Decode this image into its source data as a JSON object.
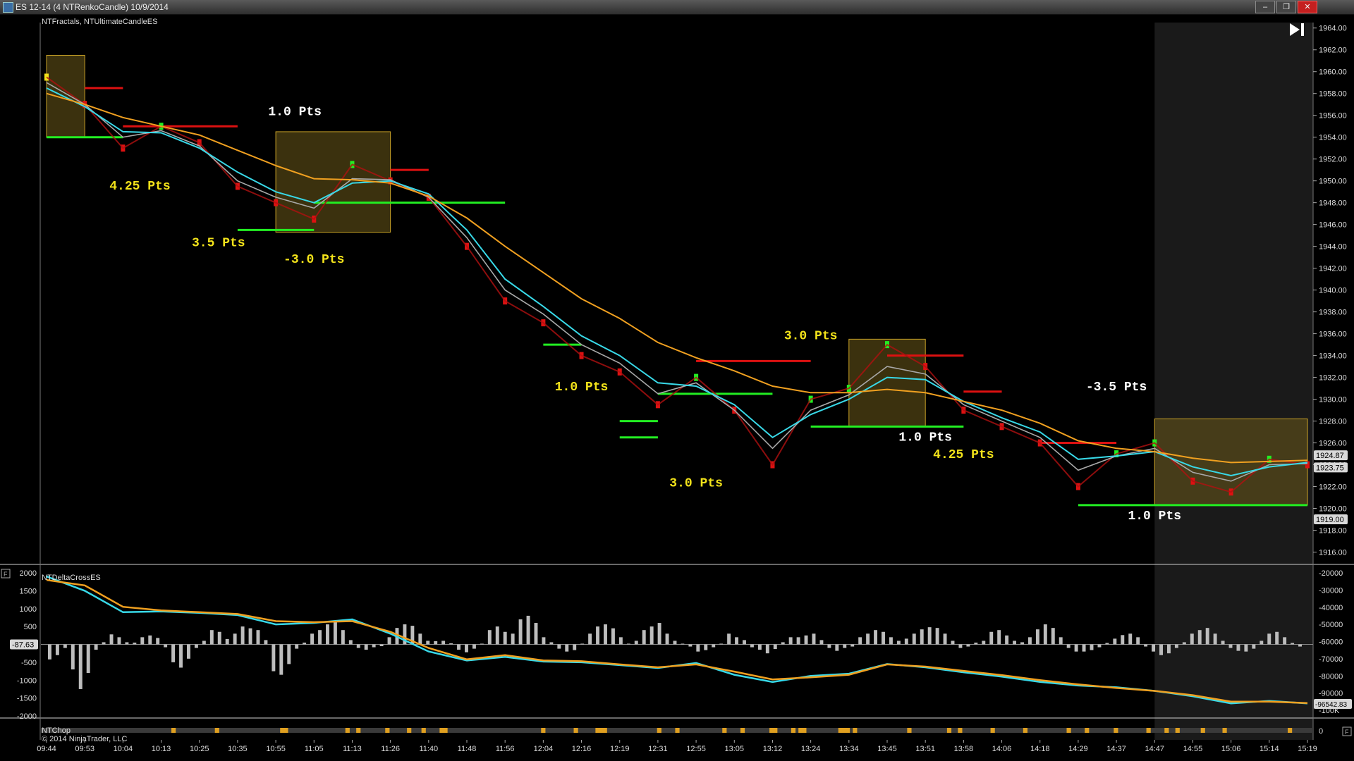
{
  "window": {
    "title": "ES 12-14 (4 NTRenkoCandle)  10/9/2014",
    "minimize": "–",
    "restore": "❐",
    "close": "✕"
  },
  "colors": {
    "background": "#000000",
    "bull": "#22ee22",
    "bear": "#dd1111",
    "neutral": "#f2e21a",
    "cyan_ma": "#38d9e8",
    "orange_ma": "#f0a020",
    "grey_ma": "#a8a8a8",
    "magenta": "#cc22cc",
    "box_fill": "#6b5a1a",
    "text_white": "#ffffff",
    "text_yellow": "#f2e21a"
  },
  "indicators": {
    "main": "NTFractals, NTUltimateCandleES",
    "delta": "NTDeltaCrossES",
    "chop": "NTChop",
    "copyright": "© 2014 NinjaTrader, LLC"
  },
  "play_icon": "skip-forward-icon",
  "chart_data": [
    {
      "type": "line",
      "name": "price-panel",
      "x": [
        "09:44",
        "09:53",
        "10:04",
        "10:13",
        "10:25",
        "10:35",
        "10:55",
        "11:05",
        "11:13",
        "11:26",
        "11:40",
        "11:48",
        "11:56",
        "12:04",
        "12:16",
        "12:19",
        "12:31",
        "12:55",
        "13:05",
        "13:12",
        "13:24",
        "13:34",
        "13:45",
        "13:51",
        "13:58",
        "14:06",
        "14:18",
        "14:29",
        "14:37",
        "14:47",
        "14:55",
        "15:06",
        "15:14",
        "15:19"
      ],
      "ylim": [
        1915,
        1964.5
      ],
      "yticks": [
        "1964.00",
        "1962.00",
        "1960.00",
        "1958.00",
        "1956.00",
        "1954.00",
        "1952.00",
        "1950.00",
        "1948.00",
        "1946.00",
        "1944.00",
        "1942.00",
        "1940.00",
        "1938.00",
        "1936.00",
        "1934.00",
        "1932.00",
        "1930.00",
        "1928.00",
        "1926.00",
        "1924.00",
        "1922.00",
        "1920.00",
        "1918.00",
        "1916.00"
      ],
      "series": [
        {
          "key": "price",
          "values": [
            1959.5,
            1957.0,
            1953.0,
            1955.0,
            1953.5,
            1949.5,
            1948.0,
            1946.5,
            1951.5,
            1950.0,
            1948.5,
            1944.0,
            1939.0,
            1937.0,
            1934.0,
            1932.5,
            1929.5,
            1932.0,
            1929.0,
            1924.0,
            1930.0,
            1931.0,
            1935.0,
            1933.0,
            1929.0,
            1927.5,
            1926.0,
            1922.0,
            1925.0,
            1926.0,
            1922.5,
            1921.5,
            1924.5,
            1924.0
          ]
        },
        {
          "key": "cyan",
          "values": [
            1958.5,
            1956.8,
            1954.5,
            1954.4,
            1953.0,
            1950.8,
            1949.0,
            1948.0,
            1949.8,
            1950.0,
            1948.8,
            1945.5,
            1941.0,
            1938.5,
            1935.8,
            1934.0,
            1931.5,
            1931.2,
            1929.5,
            1926.5,
            1928.6,
            1930.0,
            1932.0,
            1931.8,
            1929.8,
            1928.3,
            1927.0,
            1924.5,
            1924.8,
            1925.2,
            1923.8,
            1923.0,
            1923.8,
            1924.2
          ]
        },
        {
          "key": "grey",
          "values": [
            1959.0,
            1957.0,
            1954.0,
            1954.6,
            1953.2,
            1950.0,
            1948.5,
            1947.5,
            1950.2,
            1950.1,
            1948.5,
            1944.8,
            1940.0,
            1937.8,
            1935.0,
            1933.3,
            1930.5,
            1931.5,
            1929.0,
            1925.5,
            1929.0,
            1930.4,
            1933.0,
            1932.3,
            1929.5,
            1928.0,
            1926.5,
            1923.5,
            1924.8,
            1925.5,
            1923.3,
            1922.5,
            1924.0,
            1924.1
          ]
        },
        {
          "key": "orange",
          "values": [
            1958.0,
            1957.0,
            1955.8,
            1955.0,
            1954.2,
            1952.8,
            1951.4,
            1950.2,
            1950.1,
            1949.8,
            1948.6,
            1946.6,
            1944.0,
            1941.6,
            1939.2,
            1937.4,
            1935.2,
            1933.8,
            1932.6,
            1931.2,
            1930.6,
            1930.6,
            1930.9,
            1930.6,
            1929.8,
            1929.0,
            1927.8,
            1926.2,
            1925.5,
            1925.2,
            1924.6,
            1924.2,
            1924.3,
            1924.4
          ]
        }
      ],
      "price_markers": [
        "1924.87",
        "1923.75",
        "1919.00"
      ],
      "annotations": [
        {
          "text": "1.0  Pts",
          "color": "white",
          "x": "11:00",
          "y": 1956.0
        },
        {
          "text": "4.25  Pts",
          "color": "yellow",
          "x": "10:08",
          "y": 1949.2
        },
        {
          "text": "3.5  Pts",
          "color": "yellow",
          "x": "10:30",
          "y": 1944.0
        },
        {
          "text": "-3.0  Pts",
          "color": "yellow",
          "x": "11:05",
          "y": 1942.5
        },
        {
          "text": "1.0  Pts",
          "color": "yellow",
          "x": "12:16",
          "y": 1930.8
        },
        {
          "text": "3.0  Pts",
          "color": "yellow",
          "x": "13:24",
          "y": 1935.5
        },
        {
          "text": "1.0  Pts",
          "color": "white",
          "x": "13:51",
          "y": 1926.2
        },
        {
          "text": "4.25  Pts",
          "color": "yellow",
          "x": "13:58",
          "y": 1924.6
        },
        {
          "text": "3.0  Pts",
          "color": "yellow",
          "x": "12:55",
          "y": 1922.0
        },
        {
          "text": "-3.5  Pts",
          "color": "white",
          "x": "14:37",
          "y": 1930.8
        },
        {
          "text": "1.0  Pts",
          "color": "white",
          "x": "14:47",
          "y": 1919.0
        }
      ],
      "range_boxes": [
        {
          "x0": "09:44",
          "x1": "09:53",
          "y0": 1954.0,
          "y1": 1961.5
        },
        {
          "x0": "10:55",
          "x1": "11:26",
          "y0": 1945.3,
          "y1": 1954.5
        },
        {
          "x0": "13:34",
          "x1": "13:51",
          "y0": 1927.5,
          "y1": 1935.5
        },
        {
          "x0": "14:47",
          "x1": "15:19",
          "y0": 1920.3,
          "y1": 1928.2
        }
      ],
      "levels": [
        {
          "color": "bear",
          "y": 1958.5,
          "x0": "09:53",
          "x1": "10:04"
        },
        {
          "color": "bull",
          "y": 1954.0,
          "x0": "09:44",
          "x1": "10:04"
        },
        {
          "color": "bear",
          "y": 1955.0,
          "x0": "10:04",
          "x1": "10:35"
        },
        {
          "color": "bear",
          "y": 1951.0,
          "x0": "11:26",
          "x1": "11:40"
        },
        {
          "color": "bull",
          "y": 1948.0,
          "x0": "11:05",
          "x1": "11:56"
        },
        {
          "color": "bull",
          "y": 1945.5,
          "x0": "10:35",
          "x1": "11:05"
        },
        {
          "color": "bull",
          "y": 1935.0,
          "x0": "12:04",
          "x1": "12:16"
        },
        {
          "color": "bear",
          "y": 1933.5,
          "x0": "12:55",
          "x1": "13:24"
        },
        {
          "color": "bear",
          "y": 1934.0,
          "x0": "13:45",
          "x1": "13:58"
        },
        {
          "color": "bull",
          "y": 1930.5,
          "x0": "12:31",
          "x1": "13:12"
        },
        {
          "color": "bull",
          "y": 1928.0,
          "x0": "12:19",
          "x1": "12:31"
        },
        {
          "color": "bull",
          "y": 1927.5,
          "x0": "13:24",
          "x1": "13:58"
        },
        {
          "color": "bull",
          "y": 1926.5,
          "x0": "12:19",
          "x1": "12:31"
        },
        {
          "color": "bear",
          "y": 1930.7,
          "x0": "13:58",
          "x1": "14:06"
        },
        {
          "color": "bear",
          "y": 1926.0,
          "x0": "14:18",
          "x1": "14:37"
        },
        {
          "color": "bull",
          "y": 1920.3,
          "x0": "14:29",
          "x1": "15:19"
        }
      ],
      "shaded_from": "14:47"
    },
    {
      "type": "bar",
      "name": "delta-panel",
      "left_ticks": [
        "2000",
        "1500",
        "1000",
        "500",
        "-500",
        "-1000",
        "-1500",
        "-2000"
      ],
      "right_ticks": [
        "-20000",
        "-30000",
        "-40000",
        "-50000",
        "-60000",
        "-70000",
        "-80000",
        "-90000",
        "-100K"
      ],
      "left_marker": "-87.63",
      "right_marker": "-96542.83",
      "histogram": [
        -420,
        -300,
        -100,
        -700,
        -1250,
        -800,
        -150,
        60,
        280,
        200,
        60,
        50,
        200,
        250,
        180,
        -80,
        -500,
        -650,
        -400,
        -100,
        100,
        400,
        350,
        150,
        300,
        500,
        450,
        400,
        120,
        -750,
        -850,
        -550,
        -120,
        50,
        300,
        400,
        560,
        650,
        400,
        120,
        -100,
        -150,
        -80,
        -50,
        200,
        460,
        560,
        520,
        300,
        100,
        90,
        100,
        30,
        -150,
        -220,
        -120,
        20,
        400,
        500,
        350,
        300,
        700,
        800,
        600,
        200,
        60,
        -120,
        -200,
        -160,
        20,
        300,
        500,
        560,
        450,
        200,
        20,
        100,
        400,
        500,
        600,
        300,
        100,
        20,
        -60,
        -200,
        -160,
        -80,
        20,
        300,
        200,
        120,
        -80,
        -150,
        -250,
        -130,
        60,
        200,
        200,
        250,
        300,
        120,
        -100,
        -180,
        -100,
        -60,
        200,
        300,
        400,
        350,
        200,
        100,
        160,
        300,
        420,
        480,
        460,
        300,
        100,
        -100,
        -60,
        50,
        100,
        350,
        400,
        250,
        100,
        60,
        200,
        420,
        560,
        460,
        200,
        -100,
        -200,
        -200,
        -160,
        -80,
        40,
        160,
        260,
        300,
        200,
        -60,
        -200,
        -300,
        -250,
        -100,
        60,
        300,
        400,
        460,
        300,
        100,
        -100,
        -180,
        -200,
        -120,
        100,
        300,
        350,
        200,
        40,
        -60
      ],
      "series": [
        {
          "key": "cyan",
          "values": [
            1900,
            1500,
            900,
            920,
            880,
            820,
            560,
            600,
            700,
            300,
            -200,
            -450,
            -350,
            -480,
            -500,
            -580,
            -660,
            -520,
            -850,
            -1050,
            -880,
            -820,
            -550,
            -640,
            -780,
            -900,
            -1050,
            -1150,
            -1200,
            -1300,
            -1450,
            -1650,
            -1580,
            -1650
          ]
        },
        {
          "key": "orange",
          "values": [
            1800,
            1650,
            1050,
            950,
            900,
            850,
            650,
            620,
            650,
            350,
            -100,
            -420,
            -300,
            -450,
            -470,
            -560,
            -640,
            -560,
            -760,
            -980,
            -920,
            -850,
            -560,
            -620,
            -740,
            -860,
            -1000,
            -1120,
            -1220,
            -1300,
            -1420,
            -1600,
            -1600,
            -1640
          ]
        }
      ]
    },
    {
      "type": "bar",
      "name": "chop-panel",
      "ticks": [
        "0"
      ],
      "flags": [
        0,
        0,
        0,
        0,
        0,
        0,
        0,
        0,
        0,
        0,
        0,
        0,
        0,
        0,
        0,
        0,
        0,
        0,
        0,
        0,
        0,
        0,
        0,
        0,
        0,
        0,
        0,
        0,
        0,
        0,
        0,
        0,
        0,
        0,
        0,
        0,
        1,
        0,
        0,
        0,
        0,
        0,
        0,
        0,
        0,
        0,
        0,
        0,
        1,
        0,
        0,
        0,
        0,
        0,
        0,
        0,
        0,
        0,
        0,
        0,
        0,
        0,
        0,
        0,
        0,
        0,
        1,
        1,
        0,
        0,
        0,
        0,
        0,
        0,
        0,
        0,
        0,
        0,
        0,
        0,
        0,
        0,
        0,
        0,
        1,
        0,
        0,
        1,
        0,
        0,
        0,
        0,
        0,
        0,
        0,
        1,
        0,
        0,
        0,
        0,
        0,
        1,
        0,
        0,
        0,
        1,
        0,
        0,
        0,
        0,
        1,
        1,
        0,
        0,
        0,
        0,
        0,
        0,
        0,
        0,
        0,
        0,
        0,
        0,
        0,
        0,
        0,
        0,
        0,
        0,
        0,
        0,
        0,
        0,
        0,
        0,
        0,
        0,
        1,
        0,
        0,
        0,
        0,
        0,
        0,
        0,
        0,
        1,
        0,
        0,
        0,
        0,
        0,
        1,
        1,
        1,
        0,
        0,
        0,
        0,
        0,
        0,
        0,
        0,
        0,
        0,
        0,
        0,
        0,
        0,
        1,
        0,
        0,
        0,
        0,
        1,
        0,
        0,
        0,
        0,
        0,
        0,
        0,
        0,
        0,
        0,
        0,
        0,
        1,
        0,
        0,
        0,
        0,
        1,
        0,
        0,
        0,
        0,
        0,
        0,
        0,
        1,
        1,
        0,
        0,
        0,
        0,
        1,
        0,
        1,
        1,
        0,
        0,
        0,
        0,
        0,
        0,
        0,
        0,
        0,
        1,
        1,
        1,
        0,
        1,
        0,
        0,
        0,
        0,
        0,
        0,
        0,
        0,
        0,
        0,
        0,
        0,
        0,
        0,
        1,
        0,
        0,
        0,
        0,
        0,
        0,
        0,
        0,
        0,
        0,
        1,
        0,
        0,
        1,
        0,
        0,
        0,
        0,
        0,
        0,
        0,
        0,
        1,
        0,
        0,
        0,
        0,
        0,
        0,
        0,
        0,
        1,
        0,
        0,
        0,
        0,
        0,
        0,
        0,
        0,
        0,
        0,
        0,
        1,
        0,
        0,
        0,
        0,
        1,
        0,
        0,
        0,
        0,
        0,
        0,
        0,
        1,
        0,
        0,
        0,
        0,
        0,
        0,
        0,
        0,
        1,
        0,
        0,
        0,
        0,
        1,
        0,
        0,
        1,
        0,
        0,
        0,
        0,
        0,
        0,
        1,
        0,
        0,
        0,
        0,
        0,
        1,
        0,
        0,
        0,
        0,
        0,
        0,
        0,
        0,
        0,
        0,
        0,
        0,
        0,
        0,
        0,
        0,
        0,
        1,
        0,
        0,
        0,
        0,
        0,
        0
      ]
    }
  ]
}
